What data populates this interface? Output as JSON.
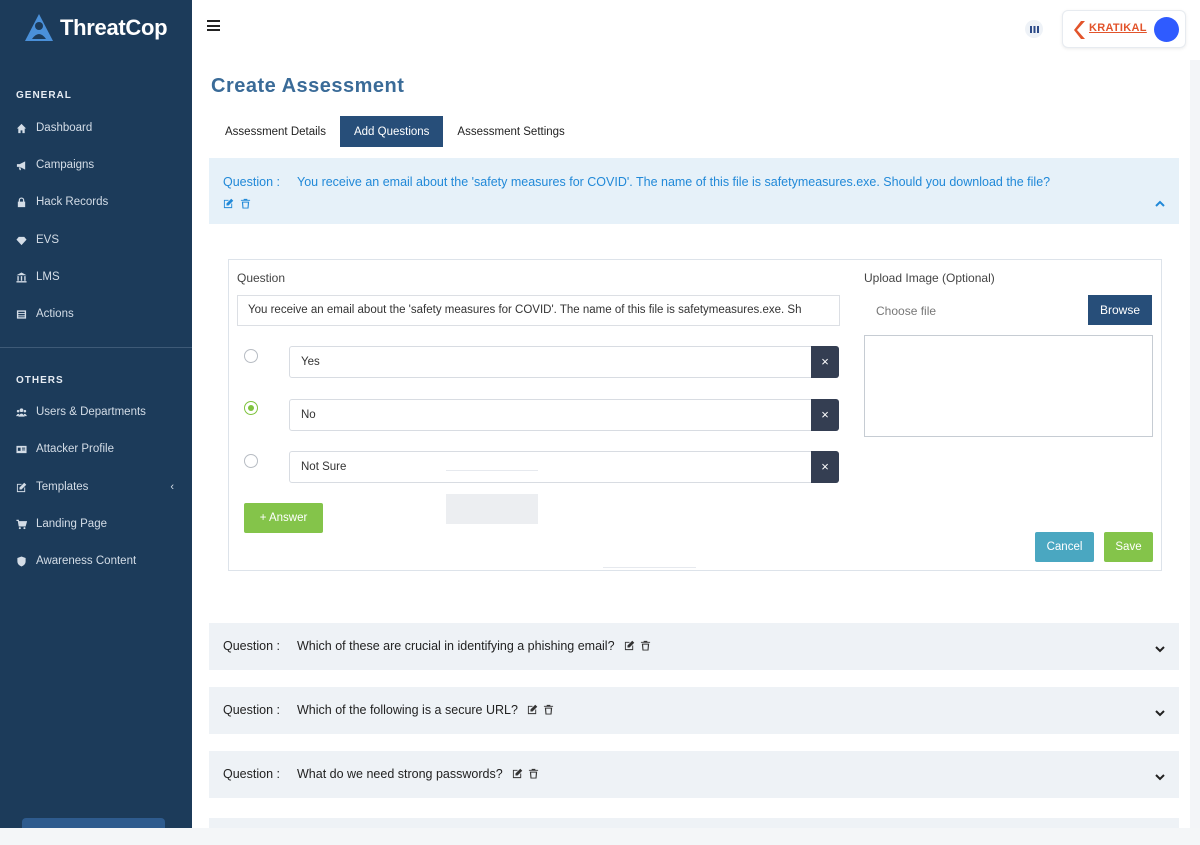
{
  "brand": {
    "name": "ThreatCop",
    "color": "#1c3b5a"
  },
  "sidebar": {
    "general_heading": "GENERAL",
    "others_heading": "OTHERS",
    "general_items": [
      {
        "label": "Dashboard",
        "icon": "home-icon"
      },
      {
        "label": "Campaigns",
        "icon": "megaphone-icon"
      },
      {
        "label": "Hack Records",
        "icon": "lock-icon"
      },
      {
        "label": "EVS",
        "icon": "diamond-icon"
      },
      {
        "label": "LMS",
        "icon": "institution-icon"
      },
      {
        "label": "Actions",
        "icon": "list-icon"
      }
    ],
    "others_items": [
      {
        "label": "Users & Departments",
        "icon": "users-icon"
      },
      {
        "label": "Attacker Profile",
        "icon": "id-card-icon"
      },
      {
        "label": "Templates",
        "icon": "edit-icon"
      },
      {
        "label": "Landing Page",
        "icon": "cart-icon"
      },
      {
        "label": "Awareness Content",
        "icon": "shield-icon"
      }
    ]
  },
  "header": {
    "org_name": "KRATIKAL"
  },
  "main": {
    "title": "Create Assessment",
    "tabs": [
      {
        "label": "Assessment Details"
      },
      {
        "label": "Add Questions"
      },
      {
        "label": "Assessment Settings"
      }
    ],
    "question_label": "Question :",
    "questions": [
      {
        "text": "You receive an email about the 'safety measures for COVID'. The name of this file is safetymeasures.exe. Should you download the file?"
      },
      {
        "text": "Which of these are crucial in identifying a phishing email?"
      },
      {
        "text": "Which of the following is a secure URL?"
      },
      {
        "text": "What do we need strong passwords?"
      }
    ],
    "editor": {
      "question_label": "Question",
      "question_value": "You receive an email about the 'safety measures for COVID'. The name of this file is safetymeasures.exe. Sh",
      "answers": [
        {
          "text": "Yes",
          "selected": false
        },
        {
          "text": "No",
          "selected": true
        },
        {
          "text": "Not Sure",
          "selected": false
        }
      ],
      "add_answer_label": "+ Answer",
      "upload_label": "Upload Image (Optional)",
      "file_placeholder": "Choose file",
      "browse_label": "Browse",
      "cancel_label": "Cancel",
      "save_label": "Save",
      "delete_glyph": "×"
    }
  },
  "colors": {
    "active_question": "#2189d8",
    "accent_green": "#84c44a",
    "tab_active": "#274e79",
    "title": "#3a6b98"
  }
}
